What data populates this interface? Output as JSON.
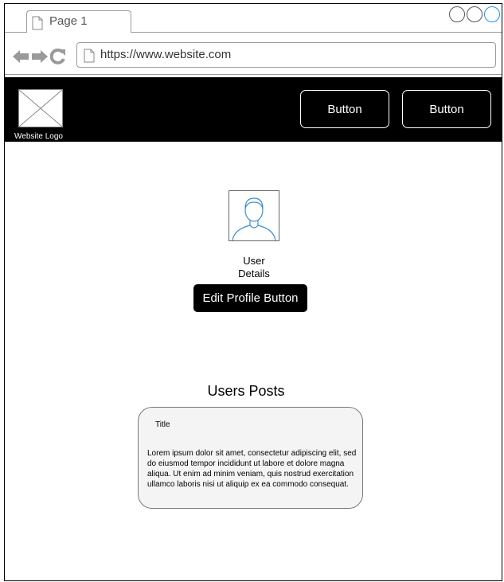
{
  "browser": {
    "tab_label": "Page 1",
    "url": "https://www.website.com"
  },
  "header": {
    "logo_caption": "Website Logo",
    "buttons": [
      "Button",
      "Button"
    ]
  },
  "profile": {
    "details_line1": "User",
    "details_line2": "Details",
    "edit_button_label": "Edit Profile Button"
  },
  "posts": {
    "heading": "Users Posts",
    "items": [
      {
        "title": "Title",
        "body": "Lorem ipsum dolor sit amet, consectetur adipiscing elit, sed do eiusmod tempor incididunt ut labore et dolore magna aliqua. Ut enim ad minim veniam, quis nostrud exercitation ullamco laboris nisi ut aliquip ex ea commodo consequat."
      }
    ]
  },
  "icons": {
    "back": "arrow-left-icon",
    "forward": "arrow-right-icon",
    "reload": "reload-icon",
    "page": "page-icon",
    "avatar": "user-avatar-icon",
    "logo": "image-placeholder-icon"
  },
  "colors": {
    "header_bg": "#000000",
    "accent_control": "#1e90ff",
    "avatar_stroke": "#3b8fd9",
    "card_bg": "#f4f4f4"
  }
}
